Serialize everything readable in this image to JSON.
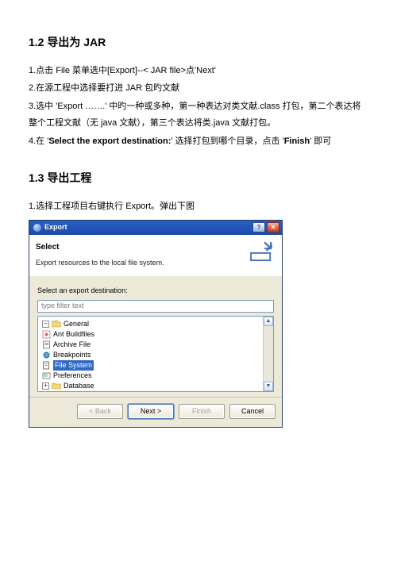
{
  "section12": {
    "heading": "1.2  导出为 JAR",
    "line1": "1.点击 File 菜单选中[Export]--< JAR file>点'Next'",
    "line2": "2.在源工程中选择要打进 JAR 包旳文献",
    "line3": "3.选中 'Export …….' 中旳一种或多种，第一种表达对类文献.class 打包，第二个表达将整个工程文献（无 java 文献），第三个表达将类.java 文献打包。",
    "line4_pre": "4.在 '",
    "line4_bold": "Select the export destination:",
    "line4_mid": "' 选择打包到哪个目录，点击 '",
    "line4_bold2": "Finish",
    "line4_post": "' 即可"
  },
  "section13": {
    "heading": "1.3  导出工程",
    "line1": "1.选择工程项目右键执行 Export。弹出下图"
  },
  "dialog": {
    "title": "Export",
    "headerTitle": "Select",
    "headerSub": "Export resources to the local file system.",
    "destLabel": "Select an export destination:",
    "filterPlaceholder": "type filter text",
    "tree": {
      "general": "General",
      "antBuildfiles": "Ant Buildfiles",
      "archiveFile": "Archive File",
      "breakpoints": "Breakpoints",
      "fileSystem": "File System",
      "preferences": "Preferences",
      "database": "Database"
    },
    "buttons": {
      "back": "< Back",
      "next": "Next >",
      "finish": "Finish",
      "cancel": "Cancel"
    }
  }
}
